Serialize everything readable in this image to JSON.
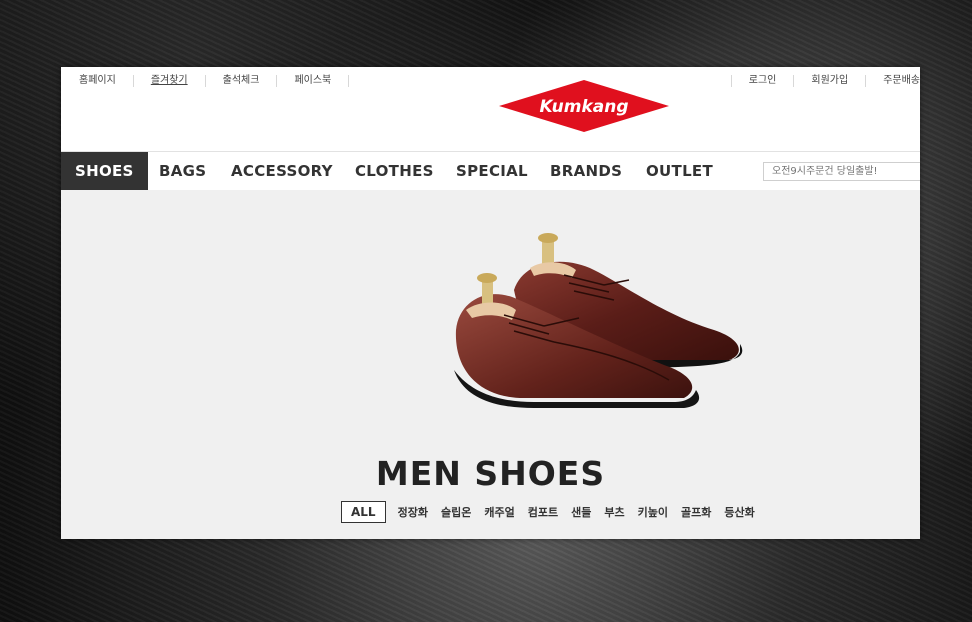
{
  "util_left": [
    "홈페이지",
    "즐겨찾기",
    "출석체크",
    "페이스북"
  ],
  "util_right": [
    "로그인",
    "회원가입",
    "주문배송"
  ],
  "logo": {
    "text": "Kumkang",
    "color": "#e0101e"
  },
  "nav": [
    "SHOES",
    "BAGS",
    "ACCESSORY",
    "CLOTHES",
    "SPECIAL",
    "BRANDS",
    "OUTLET"
  ],
  "search": {
    "placeholder": "오전9시주문건 당일출발!"
  },
  "hero": {
    "title": "MEN SHOES",
    "categories": [
      "ALL",
      "정장화",
      "슬립온",
      "캐주얼",
      "컴포트",
      "샌들",
      "부츠",
      "키높이",
      "골프화",
      "등산화"
    ]
  }
}
